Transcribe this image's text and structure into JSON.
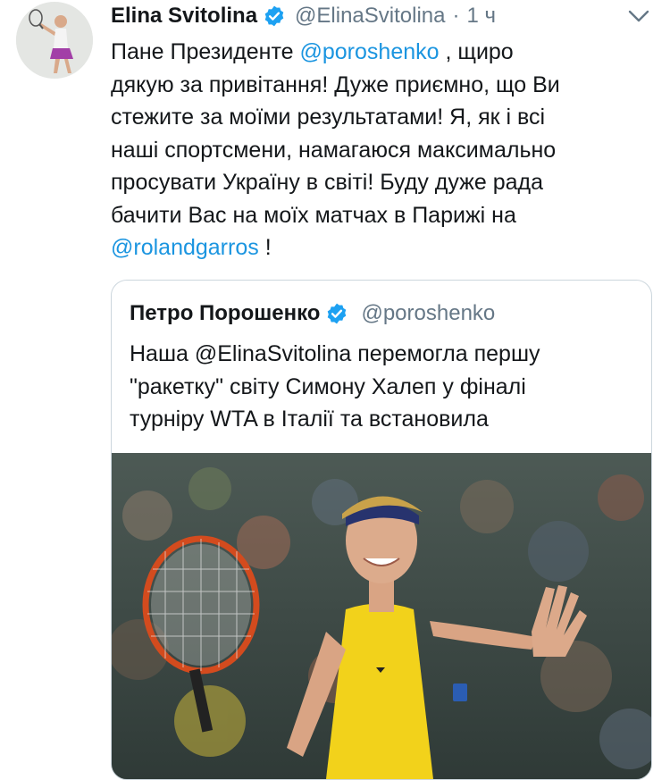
{
  "tweet": {
    "author_name": "Elina Svitolina",
    "handle": "@ElinaSvitolina",
    "separator": "·",
    "time": "1 ч",
    "verified_icon": "verified-badge-icon",
    "menu_icon": "chevron-down-icon",
    "text_lines": [
      {
        "before": "Пане Президенте ",
        "mention": "@poroshenko",
        "after": " , щиро"
      },
      {
        "before": "дякую за привітання!  Дуже приємно, що Ви",
        "mention": "",
        "after": ""
      },
      {
        "before": "стежите за моїми результатами! Я, як і всі",
        "mention": "",
        "after": ""
      },
      {
        "before": "наші спортсмени, намагаюся максимально",
        "mention": "",
        "after": ""
      },
      {
        "before": "просувати Україну в світі! Буду дуже рада",
        "mention": "",
        "after": ""
      },
      {
        "before": "бачити Вас на моїх матчах в Парижі на",
        "mention": "",
        "after": ""
      },
      {
        "before": "",
        "mention": "@rolandgarros",
        "after": " !"
      }
    ],
    "mention_color": "#1b95e0"
  },
  "quote": {
    "author_name": "Петро Порошенко",
    "handle": "@poroshenko",
    "verified_icon": "verified-badge-icon",
    "text_lines": [
      "Наша @ElinaSvitolina перемогла першу",
      "\"ракетку\" світу Симону Халеп у фіналі",
      "турніру WTA в Італії та встановила"
    ],
    "image_alt": "photo-tennis-player"
  },
  "colors": {
    "verified_blue": "#1da1f2",
    "muted": "#657786",
    "border": "#ccd6dd"
  }
}
